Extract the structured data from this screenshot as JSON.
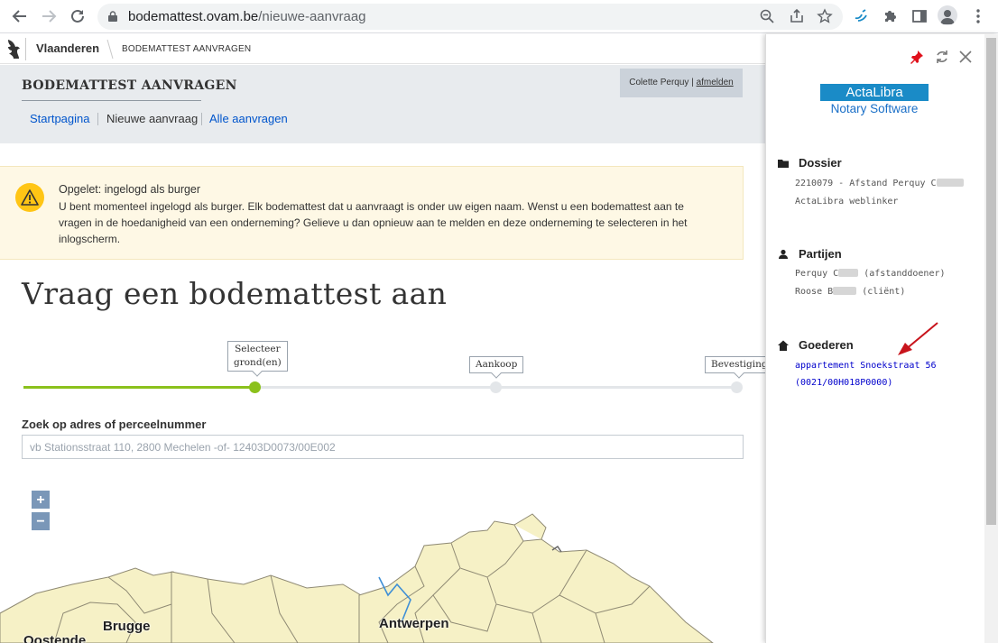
{
  "browser": {
    "url_host": "bodemattest.ovam.be",
    "url_path": "/nieuwe-aanvraag"
  },
  "site": {
    "brand": "Vlaanderen",
    "app_small": "BODEMATTEST AANVRAGEN"
  },
  "header": {
    "title": "BODEMATTEST AANVRAGEN",
    "user_name": "Colette Perquy",
    "separator": " | ",
    "logout": "afmelden",
    "tabs": [
      {
        "label": "Startpagina"
      },
      {
        "label": "Nieuwe aanvraag"
      },
      {
        "label": "Alle aanvragen"
      }
    ]
  },
  "alert": {
    "title": "Opgelet: ingelogd als burger",
    "text": "U bent momenteel ingelogd als burger. Elk bodemattest dat u aanvraagt is onder uw eigen naam. Wenst u een bodemattest aan te vragen in de hoedanigheid van een onderneming? Gelieve u dan opnieuw aan te melden en deze onderneming te selecteren in het inlogscherm."
  },
  "main": {
    "heading": "Vraag een bodemattest aan",
    "steps": [
      {
        "label_1": "Selecteer",
        "label_2": "grond(en)"
      },
      {
        "label_1": "Aankoop"
      },
      {
        "label_1": "Bevestiging"
      }
    ],
    "search_label": "Zoek op adres of perceelnummer",
    "search_placeholder": "vb Stationsstraat 110, 2800 Mechelen -of- 12403D0073/00E002",
    "zoom_in": "+",
    "zoom_out": "−",
    "map_cities": [
      "Brugge",
      "Antwerpen",
      "Oostende"
    ]
  },
  "panel": {
    "brand_top": "ActaLibra",
    "brand_bottom": "Notary Software",
    "dossier": {
      "title": "Dossier",
      "line1": "2210079 - Afstand Perquy C",
      "line2": "ActaLibra weblinker"
    },
    "partijen": {
      "title": "Partijen",
      "p1_name": "Perquy C",
      "p1_role": "(afstanddoener)",
      "p2_name": "Roose B",
      "p2_role": "(cliënt)"
    },
    "goederen": {
      "title": "Goederen",
      "link1": "appartement Snoekstraat 56",
      "link2": "(0021/00H018P0000)"
    }
  },
  "colors": {
    "link": "#0055cc",
    "progress": "#8bc11c",
    "alert_bg": "#fef8e5",
    "alert_icon": "#ffc515",
    "pin": "#e0101b",
    "brand_blue": "#1a8bc7"
  },
  "icons": {
    "back": "arrow-left-icon",
    "forward": "arrow-right-icon",
    "reload": "reload-icon",
    "lock": "lock-icon",
    "zoom": "magnifier-icon",
    "share": "share-icon",
    "bookmark": "star-icon",
    "extension_a": "extension-icon",
    "puzzle": "puzzle-icon",
    "sidepanel": "side-panel-icon",
    "profile": "profile-icon",
    "menu": "kebab-menu-icon",
    "pin": "pin-icon",
    "refresh": "refresh-icon",
    "close": "close-icon",
    "folder": "folder-icon",
    "person": "person-icon",
    "home": "house-icon",
    "warning": "warning-icon"
  }
}
